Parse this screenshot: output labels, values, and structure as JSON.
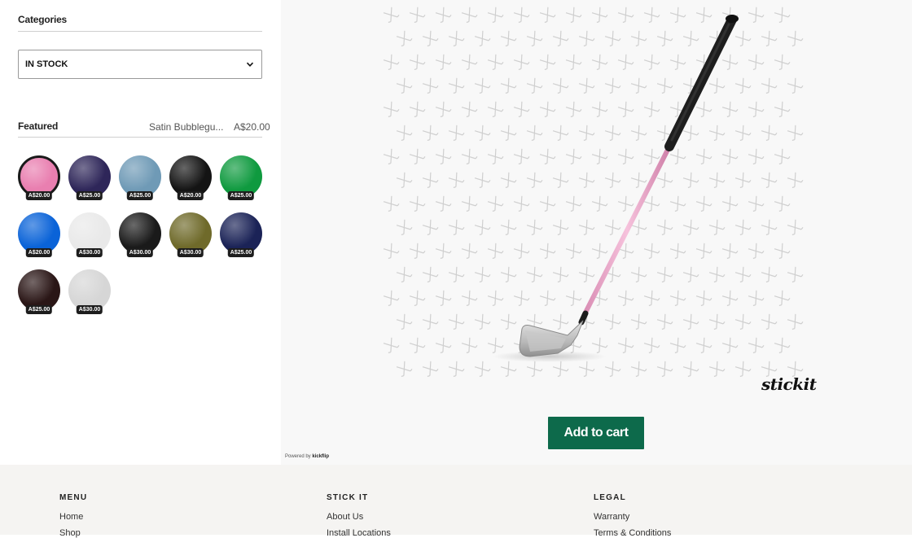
{
  "sidebar": {
    "categories_title": "Categories",
    "category_select": {
      "value": "IN STOCK"
    },
    "featured_title": "Featured",
    "featured_name": "Satin Bubblegu...",
    "featured_price": "A$20.00",
    "swatches": [
      {
        "price": "A$20.00",
        "color": "#e97fb0",
        "selected": true
      },
      {
        "price": "A$25.00",
        "color": "#2e2659"
      },
      {
        "price": "A$25.00",
        "color": "#6f9ab6"
      },
      {
        "price": "A$20.00",
        "color": "#141414"
      },
      {
        "price": "A$25.00",
        "color": "#0f9a3f"
      },
      {
        "price": "A$20.00",
        "color": "#0a63d8"
      },
      {
        "price": "A$30.00",
        "color": "#e9e9e9"
      },
      {
        "price": "A$30.00",
        "color": "#1a1a1a"
      },
      {
        "price": "A$30.00",
        "color": "#6f6a2a"
      },
      {
        "price": "A$25.00",
        "color": "#1b2357"
      },
      {
        "price": "A$25.00",
        "color": "#2a1616"
      },
      {
        "price": "A$30.00",
        "color": "#d6d6d6"
      }
    ]
  },
  "stage": {
    "brand": "stickit",
    "add_to_cart": "Add to cart",
    "powered_prefix": "Powered by",
    "powered_brand": "kickflip"
  },
  "footer": {
    "columns": [
      {
        "heading": "MENU",
        "links": [
          "Home",
          "Shop"
        ]
      },
      {
        "heading": "STICK IT",
        "links": [
          "About Us",
          "Install Locations"
        ]
      },
      {
        "heading": "LEGAL",
        "links": [
          "Warranty",
          "Terms & Conditions"
        ]
      }
    ]
  },
  "colors": {
    "accent": "#0d6a4b",
    "footer_bg": "#f5f4f2",
    "stage_bg": "#f8f8f8"
  },
  "icons": {
    "select": "chevron-down-icon",
    "pattern": "golf-club-pattern-icon"
  }
}
